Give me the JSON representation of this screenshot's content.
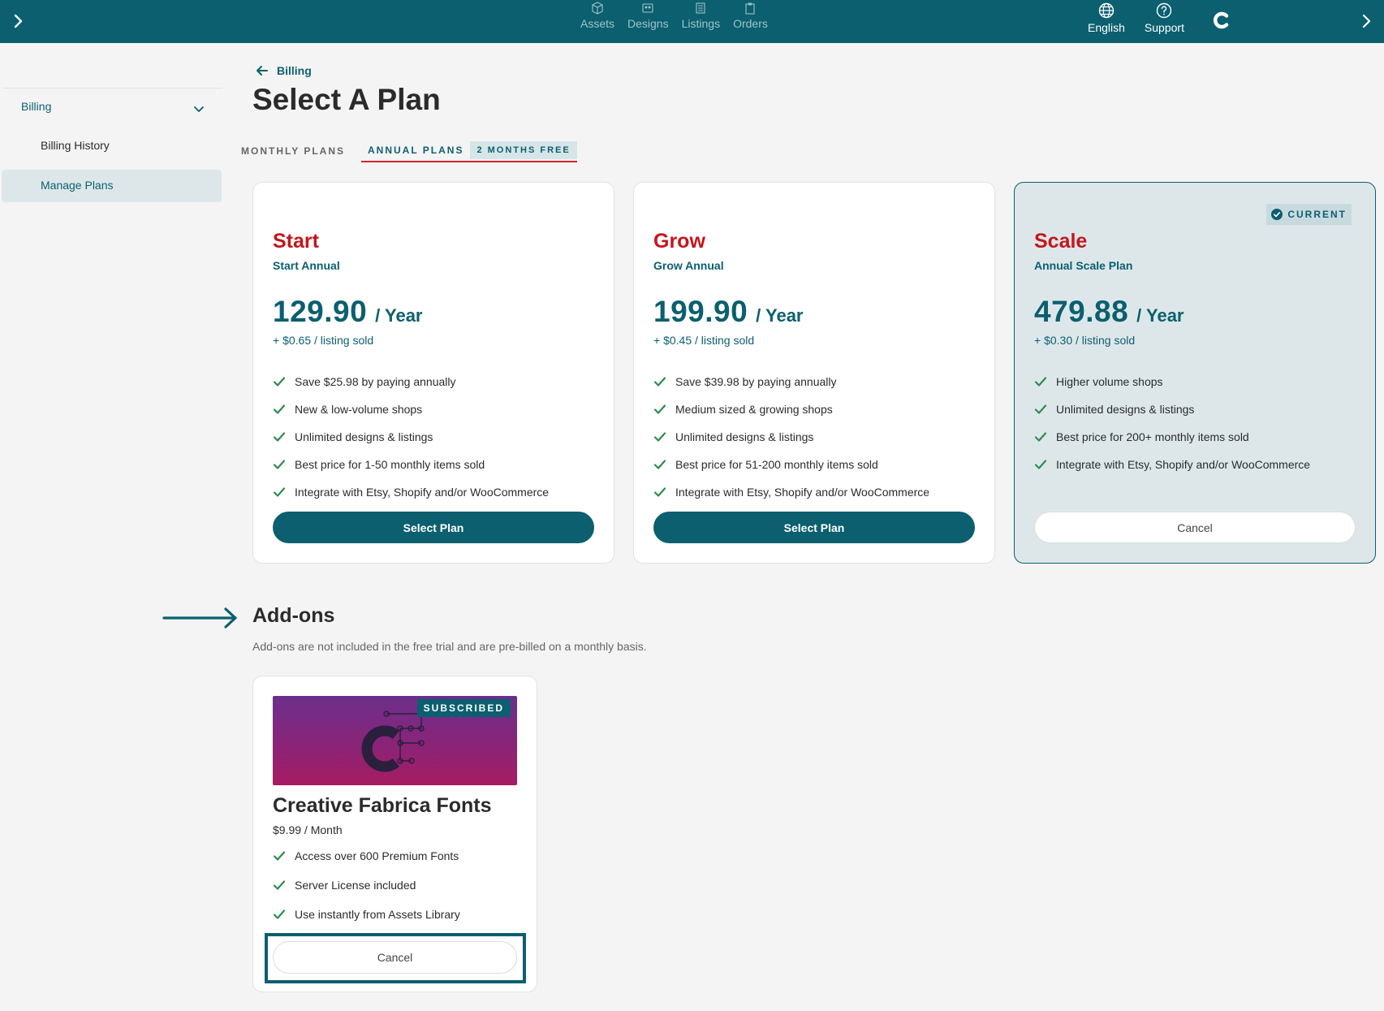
{
  "topnav": {
    "items": [
      {
        "label": "Assets",
        "icon": "box-icon"
      },
      {
        "label": "Designs",
        "icon": "designs-icon"
      },
      {
        "label": "Listings",
        "icon": "listings-icon"
      },
      {
        "label": "Orders",
        "icon": "clipboard-icon"
      }
    ],
    "language": "English",
    "support": "Support"
  },
  "sidebar": {
    "section": "Billing",
    "items": [
      {
        "label": "Billing History"
      },
      {
        "label": "Manage Plans",
        "active": true
      }
    ]
  },
  "header": {
    "back_label": "Billing",
    "title": "Select A Plan"
  },
  "tabs": {
    "monthly": "MONTHLY PLANS",
    "annual": "ANNUAL PLANS",
    "annual_badge": "2 MONTHS FREE"
  },
  "plans": [
    {
      "name": "Start",
      "subtitle": "Start Annual",
      "price": "129.90",
      "period": "/ Year",
      "fee": "+ $0.65 / listing sold",
      "features": [
        "Save $25.98 by paying annually",
        "New & low-volume shops",
        "Unlimited designs & listings",
        "Best price for 1-50 monthly items sold",
        "Integrate with Etsy, Shopify and/or WooCommerce"
      ],
      "button": "Select Plan"
    },
    {
      "name": "Grow",
      "subtitle": "Grow Annual",
      "price": "199.90",
      "period": "/ Year",
      "fee": "+ $0.45 / listing sold",
      "features": [
        "Save $39.98 by paying annually",
        "Medium sized & growing shops",
        "Unlimited designs & listings",
        "Best price for 51-200 monthly items sold",
        "Integrate with Etsy, Shopify and/or WooCommerce"
      ],
      "button": "Select Plan"
    },
    {
      "name": "Scale",
      "subtitle": "Annual Scale Plan",
      "price": "479.88",
      "period": "/ Year",
      "fee": "+ $0.30 / listing sold",
      "badge": "CURRENT",
      "features": [
        "Higher volume shops",
        "Unlimited designs & listings",
        "Best price for 200+ monthly items sold",
        "Integrate with Etsy, Shopify and/or WooCommerce"
      ],
      "button": "Cancel"
    }
  ],
  "addons": {
    "title": "Add-ons",
    "description": "Add-ons are not included in the free trial and are pre-billed on a monthly basis.",
    "items": [
      {
        "badge": "SUBSCRIBED",
        "name": "Creative Fabrica Fonts",
        "price": "$9.99 / Month",
        "features": [
          "Access over 600 Premium Fonts",
          "Server License included",
          "Use instantly from Assets Library"
        ],
        "button": "Cancel"
      }
    ]
  },
  "colors": {
    "brand": "#0b5f6f",
    "plan_name": "#c4161c",
    "check": "#2e8b4e",
    "tab_underline": "#d0262b"
  }
}
